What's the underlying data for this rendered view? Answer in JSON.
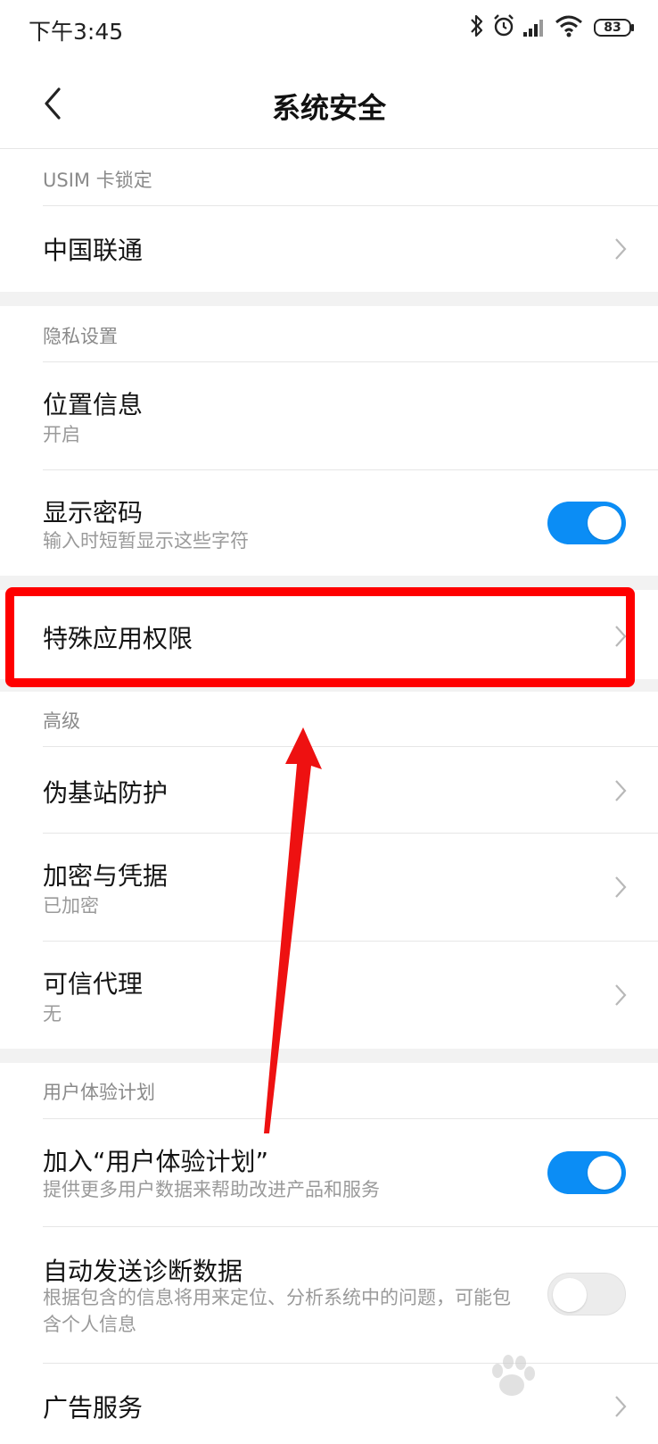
{
  "status_bar": {
    "time": "下午3:45",
    "battery": "83",
    "icons": [
      "bluetooth-icon",
      "alarm-icon",
      "signal-icon",
      "wifi-icon",
      "battery-icon"
    ]
  },
  "header": {
    "title": "系统安全",
    "back_icon": "back-chevron-icon"
  },
  "sections": {
    "usim": {
      "header": "USIM 卡锁定",
      "items": [
        {
          "title": "中国联通"
        }
      ]
    },
    "privacy": {
      "header": "隐私设置",
      "items": [
        {
          "title": "位置信息",
          "subtitle": "开启"
        },
        {
          "title": "显示密码",
          "subtitle": "输入时短暂显示这些字符",
          "toggle": true
        }
      ]
    },
    "special": {
      "items": [
        {
          "title": "特殊应用权限"
        }
      ]
    },
    "advanced": {
      "header": "高级",
      "items": [
        {
          "title": "伪基站防护"
        },
        {
          "title": "加密与凭据",
          "subtitle": "已加密"
        },
        {
          "title": "可信代理",
          "subtitle": "无"
        }
      ]
    },
    "ux_plan": {
      "header": "用户体验计划",
      "items": [
        {
          "title": "加入“用户体验计划”",
          "subtitle": "提供更多用户数据来帮助改进产品和服务",
          "toggle": true
        },
        {
          "title": "自动发送诊断数据",
          "subtitle": "根据包含的信息将用来定位、分析系统中的问题，可能包含个人信息",
          "toggle": false
        },
        {
          "title": "广告服务"
        }
      ]
    }
  },
  "annotation": {
    "highlight_color": "#ff0000",
    "arrow_color": "#ee1111"
  },
  "colors": {
    "toggle_on": "#0b8df5",
    "section_header": "#8a8a8a"
  }
}
